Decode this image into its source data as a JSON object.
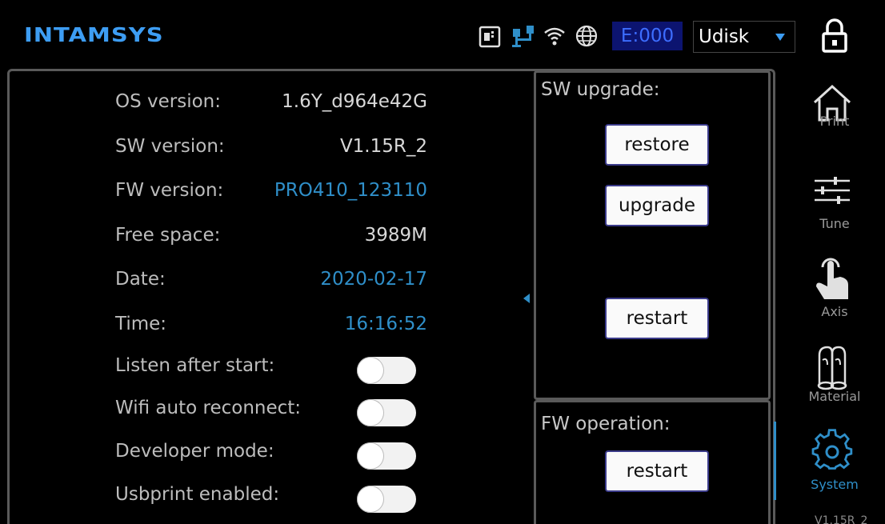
{
  "header": {
    "logo": "INTAMSYS",
    "error_code": "E:000",
    "storage_selected": "Udisk",
    "accent_color": "#3d9df3"
  },
  "info": {
    "rows": [
      {
        "label": "OS version:",
        "value": "1.6Y_d964e42G"
      },
      {
        "label": "SW version:",
        "value": "V1.15R_2"
      },
      {
        "label": "FW version:",
        "value": "PRO410_123110"
      },
      {
        "label": "Free space:",
        "value": "3989M"
      },
      {
        "label": "Date:",
        "value": "2020-02-17"
      },
      {
        "label": "Time:",
        "value": "16:16:52"
      }
    ],
    "toggles": [
      {
        "label": "Listen after start:",
        "on": false
      },
      {
        "label": "Wifi auto reconnect:",
        "on": false
      },
      {
        "label": "Developer mode:",
        "on": false
      },
      {
        "label": "Usbprint enabled:",
        "on": false
      }
    ]
  },
  "sw_upgrade": {
    "title": "SW upgrade:",
    "restore_label": "restore",
    "upgrade_label": "upgrade",
    "restart_label": "restart"
  },
  "fw_operation": {
    "title": "FW operation:",
    "restart_label": "restart"
  },
  "nav": {
    "items": [
      {
        "label": "Print",
        "icon": "home-icon"
      },
      {
        "label": "Tune",
        "icon": "sliders-icon"
      },
      {
        "label": "Axis",
        "icon": "hand-pointer-icon"
      },
      {
        "label": "Material",
        "icon": "filament-icon"
      },
      {
        "label": "System",
        "icon": "gear-icon"
      }
    ],
    "active": "System",
    "version": "V1.15R_2"
  }
}
